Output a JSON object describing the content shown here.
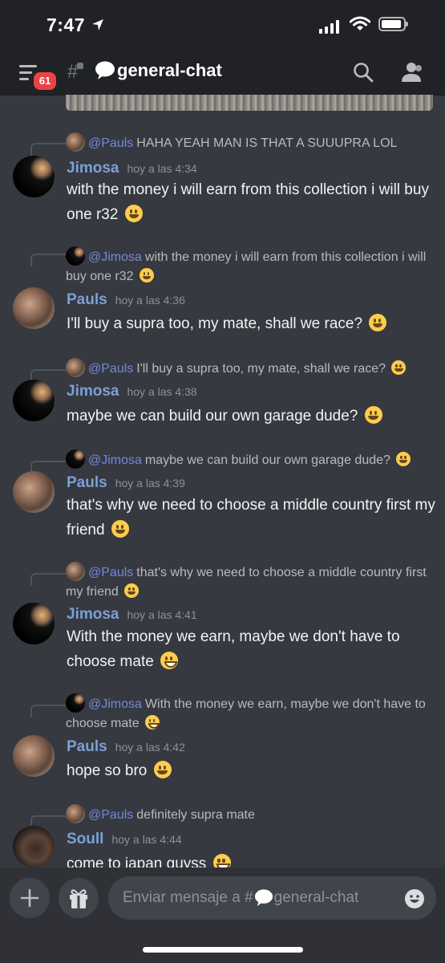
{
  "status": {
    "time": "7:47"
  },
  "header": {
    "badge": "61",
    "channel": "general-chat"
  },
  "messages": [
    {
      "reply_to": "@Pauls",
      "reply_text": "HAHA YEAH MAN IS THAT A SUUUPRA LOL",
      "author": "Jimosa",
      "time": "hoy a las 4:34",
      "text": "with the money i will earn from this collection i will buy one r32"
    },
    {
      "reply_to": "@Jimosa",
      "reply_text": "with the money i will earn from this collection i will buy one r32",
      "author": "Pauls",
      "time": "hoy a las 4:36",
      "text": "I'll buy a supra too, my mate, shall we race?"
    },
    {
      "reply_to": "@Pauls",
      "reply_text": "I'll buy a supra too, my mate, shall we race?",
      "author": "Jimosa",
      "time": "hoy a las 4:38",
      "text": "maybe we can build our own garage dude?"
    },
    {
      "reply_to": "@Jimosa",
      "reply_text": "maybe we can build our own garage dude?",
      "author": "Pauls",
      "time": "hoy a las 4:39",
      "text": "that's why we need to choose a middle country first my friend"
    },
    {
      "reply_to": "@Pauls",
      "reply_text": "that's why we need to choose a middle country first my friend",
      "author": "Jimosa",
      "time": "hoy a las 4:41",
      "text": "With the money we earn, maybe we don't have to choose mate"
    },
    {
      "reply_to": "@Jimosa",
      "reply_text": "With the money we earn, maybe we don't have to choose mate",
      "author": "Pauls",
      "time": "hoy a las 4:42",
      "text": "hope so bro"
    },
    {
      "reply_to": "@Pauls",
      "reply_text": "definitely supra mate",
      "author": "Soull",
      "time": "hoy a las 4:44",
      "text": "come to japan guyss"
    }
  ],
  "composer": {
    "placeholder_prefix": "Enviar mensaje a #",
    "placeholder_channel": "general-chat"
  }
}
